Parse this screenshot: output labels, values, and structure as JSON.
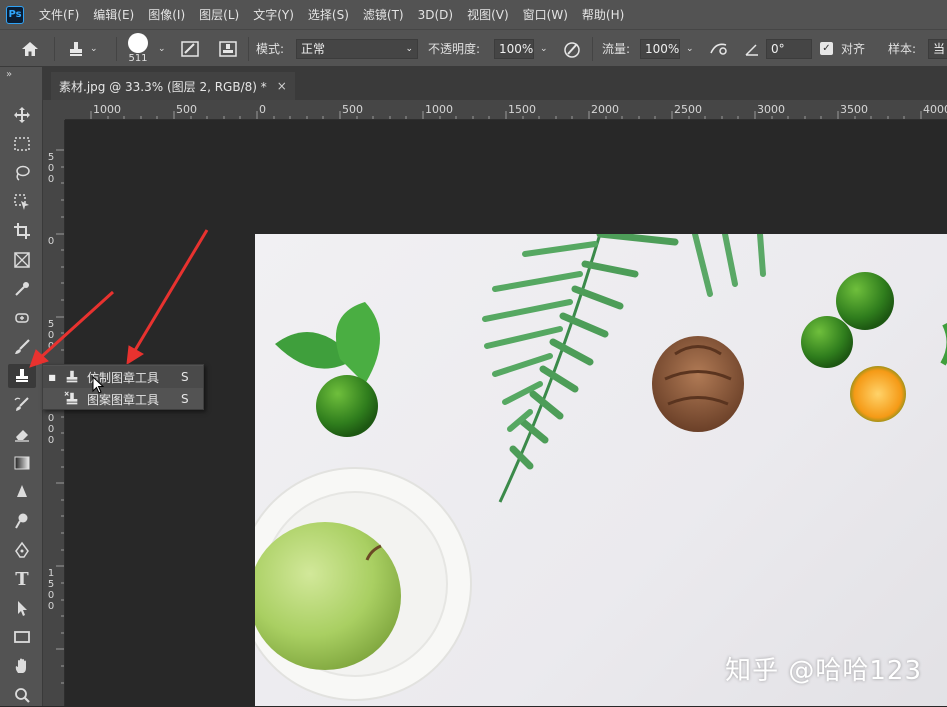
{
  "menubar": {
    "logo": "Ps",
    "items": [
      "文件(F)",
      "编辑(E)",
      "图像(I)",
      "图层(L)",
      "文字(Y)",
      "选择(S)",
      "滤镜(T)",
      "3D(D)",
      "视图(V)",
      "窗口(W)",
      "帮助(H)"
    ]
  },
  "options": {
    "brush_size": "511",
    "mode_label": "模式:",
    "mode_value": "正常",
    "opacity_label": "不透明度:",
    "opacity_value": "100%",
    "flow_label": "流量:",
    "flow_value": "100%",
    "angle_value": "0°",
    "align_label": "对齐",
    "sample_label": "样本:",
    "sample_value": "当"
  },
  "tab": {
    "title": "素材.jpg @ 33.3% (图层 2, RGB/8) *",
    "close": "×"
  },
  "collapse_glyph": "»",
  "ruler_h": [
    "1000",
    "500",
    "0",
    "500",
    "1000",
    "1500",
    "2000",
    "2500",
    "3000",
    "3500",
    "4000"
  ],
  "ruler_v": [
    [
      "5",
      "0",
      "0"
    ],
    [
      "0"
    ],
    [
      "5",
      "0",
      "0"
    ],
    [
      "1",
      "0",
      "0",
      "0"
    ],
    [
      "1",
      "5",
      "0",
      "0"
    ]
  ],
  "flyout": {
    "items": [
      {
        "label": "仿制图章工具",
        "key": "S",
        "mark": "■"
      },
      {
        "label": "图案图章工具",
        "key": "S",
        "mark": ""
      }
    ]
  },
  "watermark": "知乎 @哈哈123",
  "colors": {
    "arrow": "#e8322f",
    "accent": "#31a8ff"
  }
}
